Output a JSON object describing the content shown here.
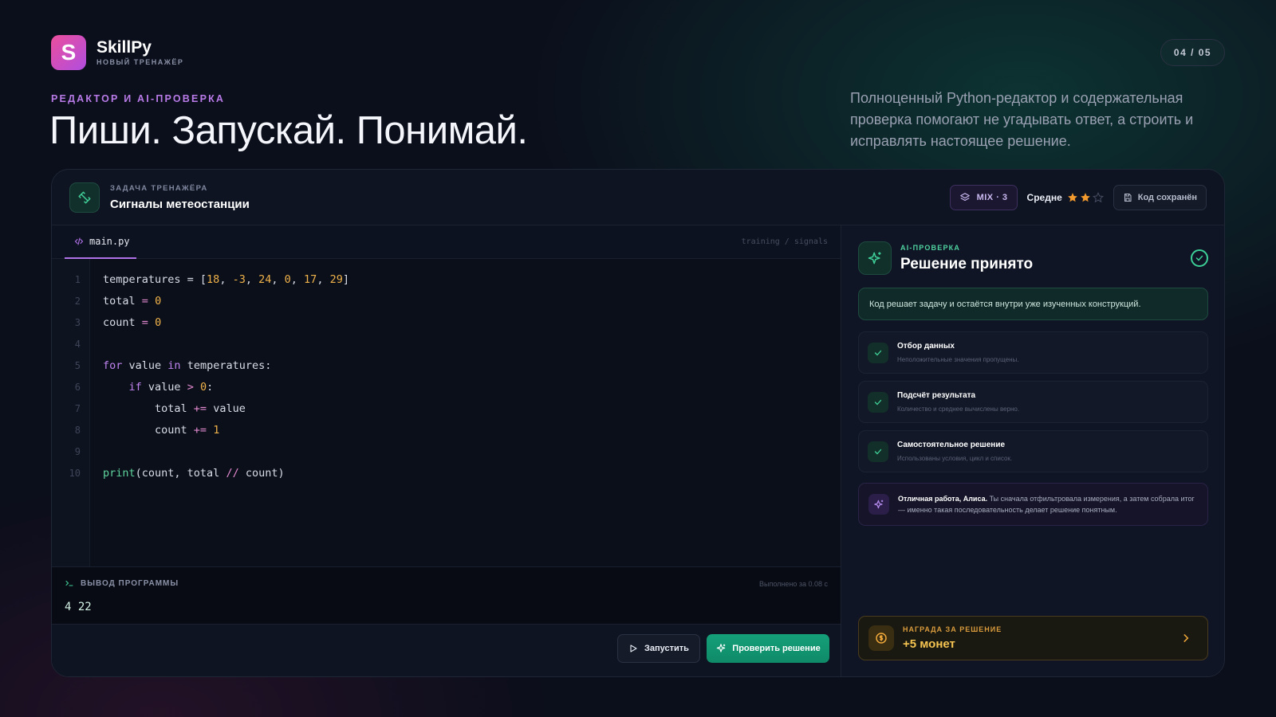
{
  "brand": {
    "logo_letter": "S",
    "name": "SkillPy",
    "subtitle": "НОВЫЙ ТРЕНАЖЁР"
  },
  "pager": "04 / 05",
  "hero": {
    "eyebrow": "РЕДАКТОР И AI-ПРОВЕРКА",
    "headline": "Пиши. Запускай. Понимай.",
    "lead": "Полноценный Python-редактор и содержательная проверка помогают не угадывать ответ, а строить и исправлять настоящее решение."
  },
  "task": {
    "eyebrow": "ЗАДАЧА ТРЕНАЖЁРА",
    "title": "Сигналы метеостанции",
    "mix_label": "MIX · 3",
    "difficulty": "Средне",
    "stars": {
      "filled": 2,
      "total": 3
    },
    "saved_label": "Код сохранён"
  },
  "editor": {
    "tab": "main.py",
    "path": "training / signals",
    "lines": [
      {
        "n": "1",
        "code": "temperatures = [18, -3, 24, 0, 17, 29]"
      },
      {
        "n": "2",
        "code": "total = 0"
      },
      {
        "n": "3",
        "code": "count = 0"
      },
      {
        "n": "4",
        "code": ""
      },
      {
        "n": "5",
        "code": "for value in temperatures:"
      },
      {
        "n": "6",
        "code": "    if value > 0:"
      },
      {
        "n": "7",
        "code": "        total += value"
      },
      {
        "n": "8",
        "code": "        count += 1"
      },
      {
        "n": "9",
        "code": ""
      },
      {
        "n": "10",
        "code": "print(count, total // count)"
      }
    ],
    "output_label": "ВЫВОД ПРОГРАММЫ",
    "output_time": "Выполнено за 0.08 с",
    "output_value": "4 22",
    "run_label": "Запустить",
    "check_label": "Проверить решение"
  },
  "ai": {
    "eyebrow": "AI-ПРОВЕРКА",
    "title": "Решение принято",
    "verdict": "Код решает задачу и остаётся внутри уже изученных конструкций.",
    "criteria": [
      {
        "title": "Отбор данных",
        "desc": "Неположительные значения пропущены."
      },
      {
        "title": "Подсчёт результата",
        "desc": "Количество и среднее вычислены верно."
      },
      {
        "title": "Самостоятельное решение",
        "desc": "Использованы условия, цикл и список."
      }
    ],
    "praise_bold": "Отличная работа, Алиса.",
    "praise_text": " Ты сначала отфильтровала измерения, а затем собрала итог — именно такая последовательность делает решение понятным.",
    "reward_eyebrow": "НАГРАДА ЗА РЕШЕНИЕ",
    "reward_value": "+5 монет"
  },
  "colors": {
    "accent_purple": "#b87be8",
    "accent_green": "#15a07a",
    "gold": "#f5c451"
  }
}
